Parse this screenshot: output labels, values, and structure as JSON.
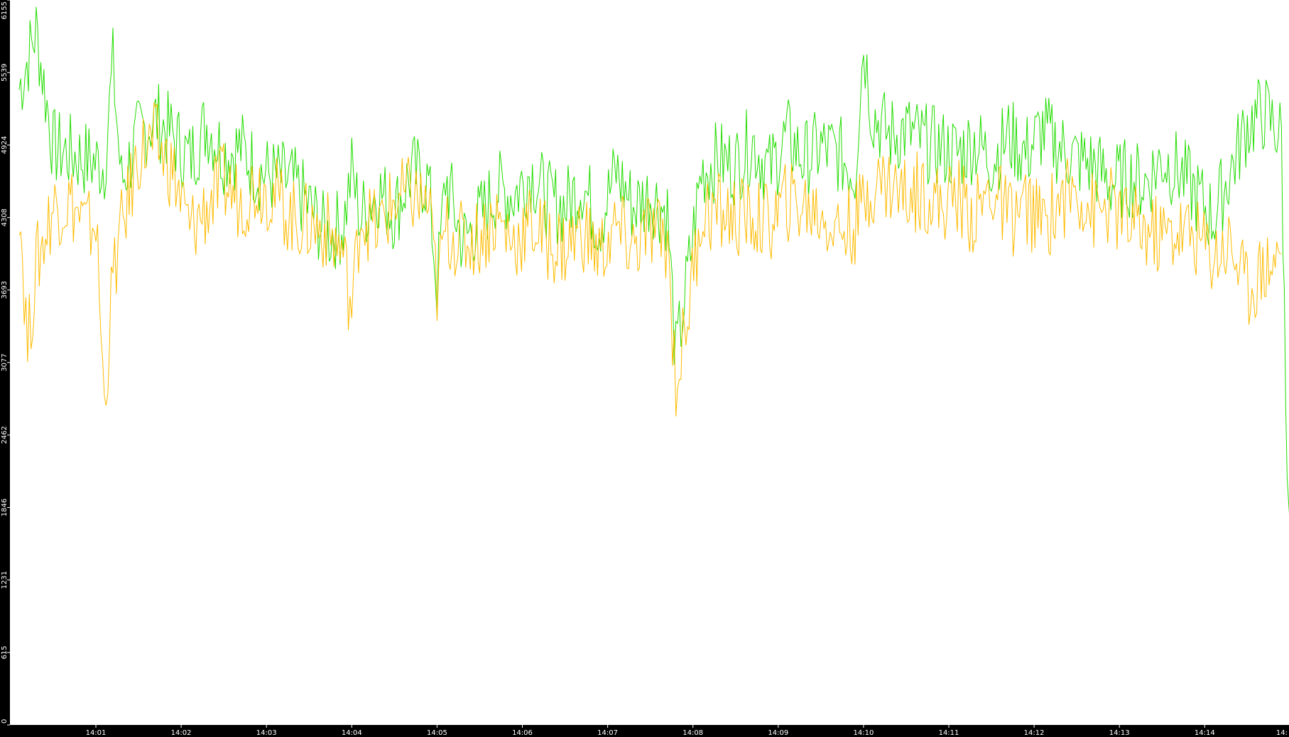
{
  "chart_data": {
    "type": "line",
    "title": "",
    "xlabel": "",
    "ylabel": "",
    "background": "#ffffff",
    "axis_background": "#000000",
    "axis_text_color": "#ffffff",
    "x_tick_labels": [
      "14:01",
      "14:02",
      "14:03",
      "14:04",
      "14:05",
      "14:06",
      "14:07",
      "14:08",
      "14:09",
      "14:10",
      "14:11",
      "14:12",
      "14:13",
      "14:14",
      "14:"
    ],
    "x_tick_minutes": [
      1,
      2,
      3,
      4,
      5,
      6,
      7,
      8,
      9,
      10,
      11,
      12,
      13,
      14,
      15
    ],
    "x_range_minutes": [
      0.1,
      15.0
    ],
    "y_tick_labels": [
      "0",
      "615",
      "1231",
      "1846",
      "2462",
      "3077",
      "3693",
      "4308",
      "4924",
      "5539",
      "6155"
    ],
    "y_tick_values": [
      0,
      615,
      1231,
      1846,
      2462,
      3077,
      3693,
      4308,
      4924,
      5539,
      6155
    ],
    "ylim": [
      0,
      6155
    ],
    "grid": false,
    "legend": "none",
    "series": [
      {
        "color": "#22dd00",
        "x": [
          0.1,
          0.3,
          0.5,
          0.7,
          0.9,
          1.1,
          1.2,
          1.3,
          1.5,
          1.7,
          1.9,
          2.1,
          2.3,
          2.5,
          2.7,
          2.9,
          3.1,
          3.3,
          3.5,
          3.7,
          3.9,
          4.0,
          4.1,
          4.3,
          4.5,
          4.7,
          4.9,
          5.0,
          5.1,
          5.3,
          5.5,
          5.7,
          5.9,
          6.1,
          6.3,
          6.5,
          6.7,
          6.9,
          7.1,
          7.3,
          7.5,
          7.7,
          7.8,
          7.9,
          8.1,
          8.3,
          8.5,
          8.7,
          8.9,
          9.1,
          9.3,
          9.5,
          9.7,
          9.9,
          10.0,
          10.1,
          10.3,
          10.5,
          10.7,
          10.9,
          11.1,
          11.3,
          11.5,
          11.7,
          11.9,
          12.1,
          12.3,
          12.5,
          12.7,
          12.9,
          13.1,
          13.3,
          13.5,
          13.7,
          13.9,
          14.1,
          14.3,
          14.5,
          14.7,
          14.9,
          14.95,
          15.0
        ],
        "y": [
          5400,
          5900,
          4900,
          4850,
          4800,
          4750,
          5600,
          4600,
          5000,
          5150,
          5000,
          4800,
          5100,
          4850,
          4900,
          4700,
          4650,
          4600,
          4400,
          4150,
          4250,
          4700,
          4300,
          4550,
          4350,
          4700,
          4600,
          3700,
          4650,
          4100,
          4300,
          4550,
          4500,
          4700,
          4450,
          4400,
          4600,
          4250,
          4700,
          4400,
          4500,
          4350,
          3100,
          3600,
          4700,
          4800,
          4750,
          4950,
          4700,
          5000,
          4800,
          4900,
          4850,
          4700,
          5800,
          5200,
          5000,
          5050,
          4950,
          4900,
          4850,
          4950,
          4800,
          5000,
          4850,
          5050,
          4900,
          4800,
          4750,
          4600,
          4650,
          4600,
          4800,
          4700,
          4500,
          4300,
          4700,
          5100,
          5200,
          5000,
          2800,
          1700
        ]
      },
      {
        "color": "#ffbb00",
        "x": [
          0.1,
          0.2,
          0.3,
          0.5,
          0.7,
          0.9,
          1.0,
          1.1,
          1.2,
          1.3,
          1.5,
          1.7,
          1.9,
          2.1,
          2.3,
          2.5,
          2.7,
          2.9,
          3.1,
          3.3,
          3.5,
          3.7,
          3.9,
          4.0,
          4.1,
          4.3,
          4.5,
          4.7,
          4.9,
          5.0,
          5.1,
          5.3,
          5.5,
          5.7,
          5.9,
          6.1,
          6.3,
          6.5,
          6.7,
          6.9,
          7.1,
          7.3,
          7.5,
          7.7,
          7.8,
          7.9,
          8.1,
          8.3,
          8.5,
          8.7,
          8.9,
          9.1,
          9.3,
          9.5,
          9.7,
          9.9,
          10.1,
          10.3,
          10.5,
          10.7,
          10.9,
          11.1,
          11.3,
          11.5,
          11.7,
          11.9,
          12.1,
          12.3,
          12.5,
          12.7,
          12.9,
          13.1,
          13.3,
          13.5,
          13.7,
          13.9,
          14.1,
          14.3,
          14.5,
          14.7,
          14.9
        ],
        "y": [
          4500,
          3200,
          3900,
          4400,
          4450,
          4200,
          4300,
          2700,
          3800,
          4200,
          4850,
          4950,
          4700,
          4200,
          4400,
          4600,
          4450,
          4600,
          4500,
          4300,
          4250,
          4200,
          4000,
          3500,
          4350,
          4200,
          4450,
          4500,
          4400,
          3700,
          4200,
          4100,
          4150,
          4300,
          4100,
          4250,
          4100,
          4050,
          4200,
          4000,
          4200,
          4050,
          4200,
          4100,
          2900,
          3300,
          4350,
          4350,
          4300,
          4300,
          4250,
          4450,
          4400,
          4350,
          4200,
          4250,
          4600,
          4600,
          4500,
          4550,
          4400,
          4500,
          4300,
          4550,
          4300,
          4400,
          4250,
          4450,
          4550,
          4350,
          4400,
          4250,
          4200,
          4150,
          4200,
          4150,
          4000,
          4100,
          3700,
          3900,
          4000
        ]
      }
    ]
  }
}
